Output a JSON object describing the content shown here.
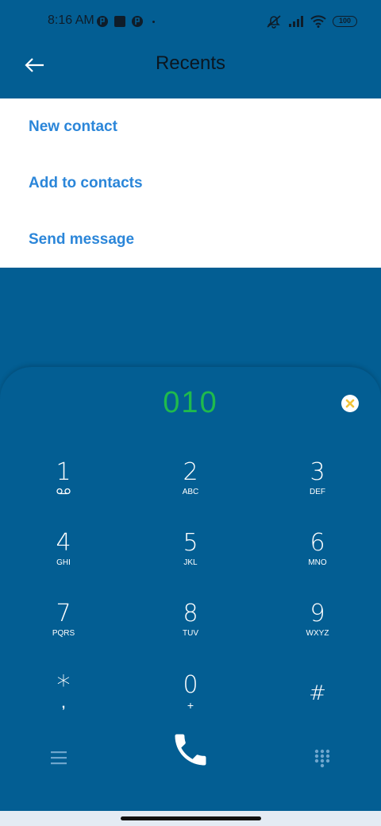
{
  "status_bar": {
    "time": "8:16 AM",
    "battery": "100",
    "icons": [
      "dnd-icon",
      "notif-icon-1",
      "notif-icon-2",
      "notif-icon-3",
      "mute-icon",
      "signal-icon",
      "wifi-icon",
      "battery-icon"
    ]
  },
  "header": {
    "title": "Recents",
    "back_icon": "arrow-left-icon"
  },
  "menu": {
    "items": [
      {
        "label": "New contact"
      },
      {
        "label": "Add to contacts"
      },
      {
        "label": "Send message"
      }
    ]
  },
  "dialer": {
    "number": "010",
    "keys": [
      {
        "digit": "1",
        "letters": ""
      },
      {
        "digit": "2",
        "letters": "ABC"
      },
      {
        "digit": "3",
        "letters": "DEF"
      },
      {
        "digit": "4",
        "letters": "GHI"
      },
      {
        "digit": "5",
        "letters": "JKL"
      },
      {
        "digit": "6",
        "letters": "MNO"
      },
      {
        "digit": "7",
        "letters": "PQRS"
      },
      {
        "digit": "8",
        "letters": "TUV"
      },
      {
        "digit": "9",
        "letters": "WXYZ"
      },
      {
        "digit": "*",
        "letters": ","
      },
      {
        "digit": "0",
        "letters": "+"
      },
      {
        "digit": "#",
        "letters": ""
      }
    ]
  },
  "colors": {
    "background": "#035e93",
    "menu_text": "#2b86d9",
    "number_text": "#1fba4d",
    "clear_button": "#f2c43a"
  }
}
